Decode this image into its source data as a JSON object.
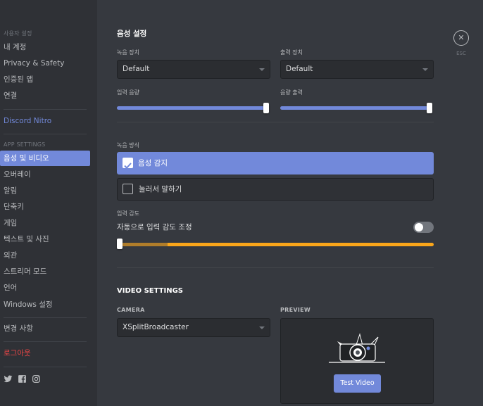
{
  "sidebar": {
    "user_settings_header": "사용자 설정",
    "user_items": [
      "내 계정",
      "Privacy & Safety",
      "인증된 앱",
      "연결"
    ],
    "nitro": "Discord Nitro",
    "app_settings_header": "APP SETTINGS",
    "app_items": [
      "음성 및 비디오",
      "오버레이",
      "알림",
      "단축키",
      "게임",
      "텍스트 및 사진",
      "외관",
      "스트리머 모드",
      "언어",
      "Windows 설정"
    ],
    "changelog": "변경 사항",
    "logout": "로그아웃",
    "social_icons": [
      "twitter-icon",
      "facebook-icon",
      "instagram-icon"
    ]
  },
  "close": {
    "symbol": "✕",
    "label": "ESC"
  },
  "voice": {
    "title": "음성 설정",
    "input_device_label": "녹음 장치",
    "input_device_value": "Default",
    "output_device_label": "출력 장치",
    "output_device_value": "Default",
    "input_volume_label": "입력 음량",
    "input_volume_level": 1.0,
    "output_volume_label": "음량 출력",
    "output_volume_level": 1.0,
    "input_mode_label": "녹음 방식",
    "input_mode_options": [
      {
        "label": "음성 감지",
        "checked": true
      },
      {
        "label": "눌러서 말하기",
        "checked": false
      }
    ],
    "sensitivity_label": "입력 감도",
    "auto_sensitivity_label": "자동으로 입력 감도 조정",
    "auto_sensitivity_enabled": false
  },
  "video": {
    "title": "VIDEO SETTINGS",
    "camera_label": "CAMERA",
    "camera_value": "XSplitBroadcaster",
    "preview_label": "PREVIEW",
    "test_button": "Test Video"
  },
  "colors": {
    "accent": "#7289da",
    "sidebar_bg": "#2f3136",
    "main_bg": "#36393f",
    "danger": "#f04747",
    "sensitivity": "#faa61a"
  }
}
